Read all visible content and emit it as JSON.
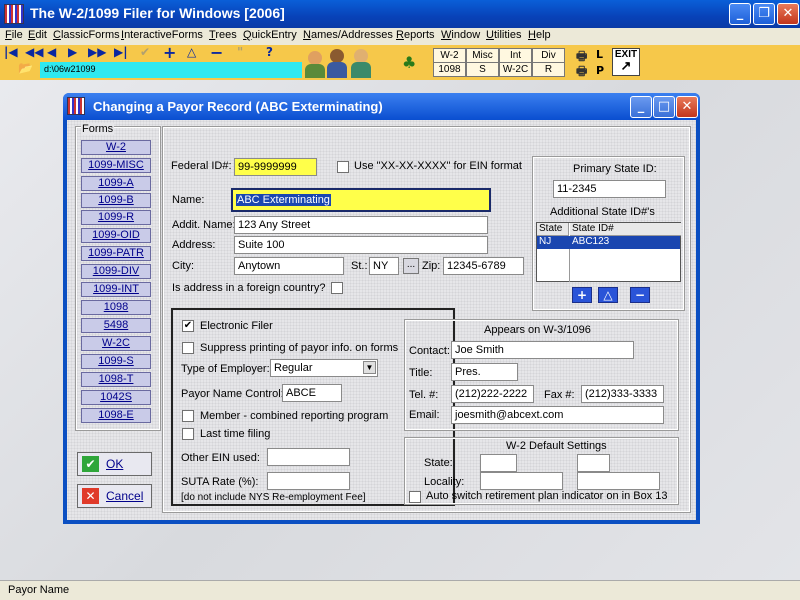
{
  "window": {
    "title": "The W-2/1099 Filer for Windows [2006]"
  },
  "menu": [
    "File",
    "Edit",
    "ClassicForms",
    "InteractiveForms",
    "Trees",
    "QuickEntry",
    "Names/Addresses",
    "Reports",
    "Window",
    "Utilities",
    "Help"
  ],
  "toolbar": {
    "path": "d:\\06w21099",
    "form_buttons": [
      [
        "W-2",
        "Misc",
        "Int",
        "Div"
      ],
      [
        "1098",
        "S",
        "W-2C",
        "R"
      ]
    ],
    "print_l": "L",
    "print_p": "P",
    "exit_label": "EXIT"
  },
  "dialog": {
    "title": "Changing a Payor Record  (ABC Exterminating)",
    "forms_label": "Forms",
    "forms": [
      "W-2",
      "1099-MISC",
      "1099-A",
      "1099-B",
      "1099-R",
      "1099-OID",
      "1099-PATR",
      "1099-DIV",
      "1099-INT",
      "1098",
      "5498",
      "W-2C",
      "1099-S",
      "1098-T",
      "1042S",
      "1098-E"
    ],
    "ok_label": "OK",
    "cancel_label": "Cancel",
    "federal_id_label": "Federal ID#:",
    "federal_id": "99-9999999",
    "use_xx_label": "Use \"XX-XX-XXXX\" for EIN format",
    "name_label": "Name:",
    "name": "ABC Exterminating",
    "addit_name_label": "Addit. Name:",
    "addit_name": "123 Any Street",
    "address_label": "Address:",
    "address": "Suite 100",
    "city_label": "City:",
    "city": "Anytown",
    "st_label": "St.:",
    "st": "NY",
    "zip_label": "Zip:",
    "zip": "12345-6789",
    "foreign_label": "Is address in a foreign country?",
    "primary_state_label": "Primary State ID:",
    "primary_state": "11-2345",
    "additional_state_label": "Additional State ID#'s",
    "state_table": {
      "headers": [
        "State",
        "State ID#"
      ],
      "rows": [
        [
          "NJ",
          "ABC123"
        ]
      ]
    },
    "electronic_filer_label": "Electronic Filer",
    "suppress_label": "Suppress printing of payor info. on forms",
    "type_employer_label": "Type of Employer:",
    "type_employer": "Regular",
    "payor_name_control_label": "Payor Name Control:",
    "payor_name_control": "ABCE",
    "member_label": "Member - combined reporting program",
    "last_time_label": "Last time filing",
    "other_ein_label": "Other EIN used:",
    "suta_label": "SUTA Rate (%):",
    "suta_note": "[do not include NYS Re-employment Fee]",
    "w3_title": "Appears on W-3/1096",
    "contact_label": "Contact:",
    "contact": "Joe Smith",
    "title_label": "Title:",
    "title_value": "Pres.",
    "tel_label": "Tel. #:",
    "tel": "(212)222-2222",
    "fax_label": "Fax #:",
    "fax": "(212)333-3333",
    "email_label": "Email:",
    "email": "joesmith@abcext.com",
    "w2_defaults_title": "W-2 Default Settings",
    "state_label": "State:",
    "locality_label": "Locality:",
    "auto_switch_label": "Auto switch retirement plan indicator on in Box 13"
  },
  "status": {
    "text": "Payor Name"
  }
}
